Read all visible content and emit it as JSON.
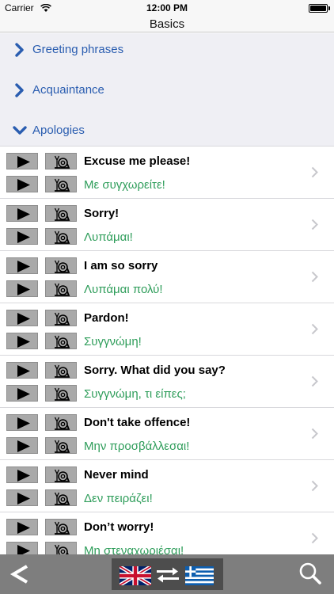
{
  "status_bar": {
    "carrier": "Carrier",
    "time": "12:00 PM"
  },
  "nav": {
    "title": "Basics"
  },
  "sections": [
    {
      "label": "Greeting phrases",
      "state": "collapsed"
    },
    {
      "label": "Acquaintance",
      "state": "collapsed"
    },
    {
      "label": "Apologies",
      "state": "expanded"
    }
  ],
  "phrases": [
    {
      "en": "Excuse me please!",
      "gr": "Με συγχωρείτε!"
    },
    {
      "en": "Sorry!",
      "gr": "Λυπάμαι!"
    },
    {
      "en": "I am so sorry",
      "gr": "Λυπάμαι πολύ!"
    },
    {
      "en": "Pardon!",
      "gr": "Συγγνώμη!"
    },
    {
      "en": "Sorry. What did you say?",
      "gr": "Συγγνώμη, τι είπες;"
    },
    {
      "en": "Don't take offence!",
      "gr": "Μην προσβάλλεσαι!"
    },
    {
      "en": "Never mind",
      "gr": "Δεν πειράζει!"
    },
    {
      "en": "Don’t worry!",
      "gr": "Μη στεναχωριέσαι!"
    }
  ],
  "icons": {
    "play": "play-icon",
    "slow_play": "snail-icon",
    "disclosure": "chevron-right-icon",
    "back": "back-chevron-icon",
    "search": "magnifier-icon",
    "language_from": "uk-flag-icon",
    "language_to": "greek-flag-icon",
    "swap": "swap-arrows-icon"
  },
  "colors": {
    "section_label": "#2a5db0",
    "greek_text": "#2e9d5a",
    "toolbar": "#7e7e7e",
    "section_background": "#efeff4"
  }
}
